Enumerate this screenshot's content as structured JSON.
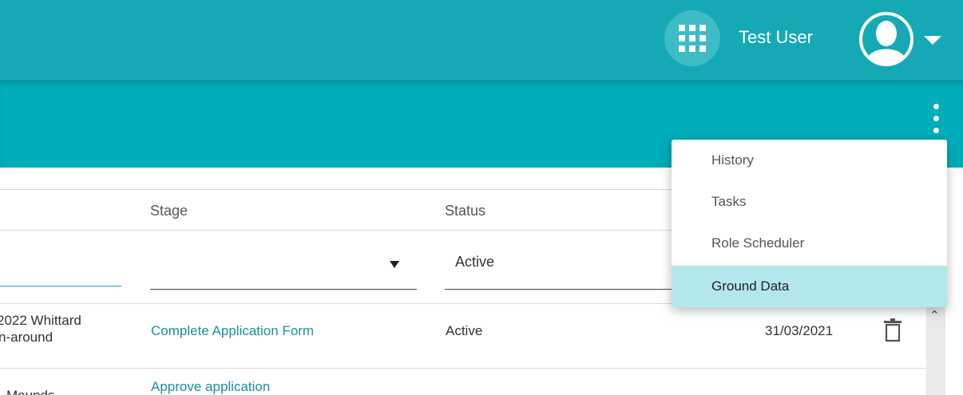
{
  "header": {
    "user_name": "Test User",
    "apps_icon": "apps-grid-icon",
    "avatar_icon": "user-avatar-icon",
    "dropdown_icon": "caret-down-icon",
    "color_primary": "#14a9b5",
    "color_secondary": "#00adba"
  },
  "toolbar": {
    "more_icon": "more-vertical-icon"
  },
  "table": {
    "columns": {
      "stage": "Stage",
      "status": "Status"
    },
    "filters": {
      "status_value": "Active"
    },
    "rows": [
      {
        "name_line1": "2022 Whittard",
        "name_line2": "n-around",
        "stage": "Complete Application Form",
        "status": "Active",
        "date": "31/03/2021"
      },
      {
        "name_line1": "Mounds",
        "stage": "Approve application"
      }
    ]
  },
  "menu": {
    "items": [
      {
        "label": "History"
      },
      {
        "label": "Tasks"
      },
      {
        "label": "Role Scheduler"
      },
      {
        "label": "Ground Data"
      }
    ],
    "active_index": 3,
    "highlight_color": "#b2e8ec"
  }
}
